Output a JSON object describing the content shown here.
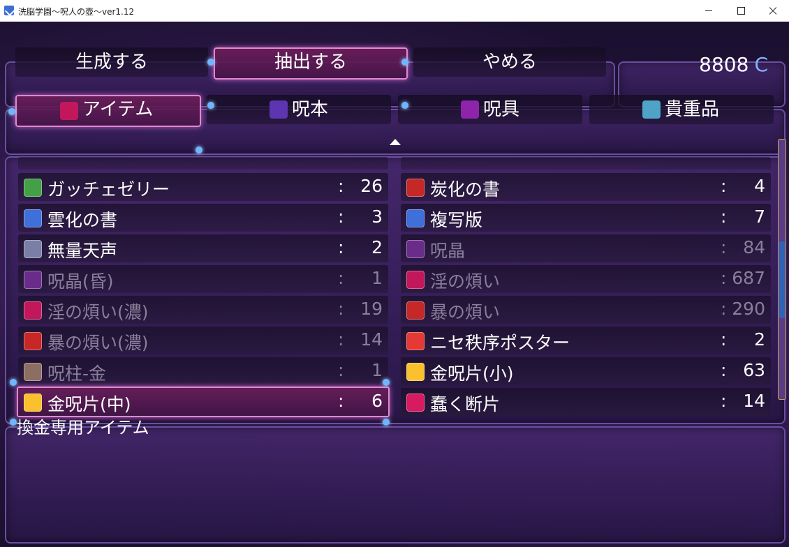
{
  "window": {
    "title": "洗脳学園～呪人の壺～ver1.12"
  },
  "commands": {
    "create_label": "生成する",
    "extract_label": "抽出する",
    "cancel_label": "やめる",
    "selected": "extract"
  },
  "gold": {
    "amount": "8808",
    "unit": "C"
  },
  "tabs": [
    {
      "label": "アイテム",
      "icon": "gem-icon",
      "color": "#c2185b",
      "selected": true
    },
    {
      "label": "呪本",
      "icon": "spellbook-icon",
      "color": "#5e35b1",
      "selected": false
    },
    {
      "label": "呪具",
      "icon": "skeleton-key-icon",
      "color": "#8e24aa",
      "selected": false
    },
    {
      "label": "貴重品",
      "icon": "frame-icon",
      "color": "#4fa3c7",
      "selected": false
    }
  ],
  "items_left": [
    {
      "name": "ガッチェゼリー",
      "count": "26",
      "icon": "mug-icon",
      "color": "#43a047",
      "dim": false,
      "selected": false
    },
    {
      "name": "雲化の書",
      "count": "3",
      "icon": "book-blue-icon",
      "color": "#3f6fd8",
      "dim": false,
      "selected": false
    },
    {
      "name": "無量天声",
      "count": "2",
      "icon": "book-white-icon",
      "color": "#7a7fa8",
      "dim": false,
      "selected": false
    },
    {
      "name": "呪晶(昏)",
      "count": "1",
      "icon": "dark-orb-icon",
      "color": "#6a2c8a",
      "dim": true,
      "selected": false
    },
    {
      "name": "淫の煩い(濃)",
      "count": "19",
      "icon": "pink-flame-icon",
      "color": "#c2185b",
      "dim": true,
      "selected": false
    },
    {
      "name": "暴の煩い(濃)",
      "count": "14",
      "icon": "red-flame-icon",
      "color": "#c62828",
      "dim": true,
      "selected": false
    },
    {
      "name": "呪柱-金",
      "count": "1",
      "icon": "pillar-icon",
      "color": "#8d6e63",
      "dim": true,
      "selected": false
    },
    {
      "name": "金呪片(中)",
      "count": "6",
      "icon": "gold-triangle-icon",
      "color": "#fbc02d",
      "dim": false,
      "selected": true
    }
  ],
  "items_right": [
    {
      "name": "炭化の書",
      "count": "4",
      "icon": "book-red-icon",
      "color": "#c62828",
      "dim": false,
      "selected": false
    },
    {
      "name": "複写版",
      "count": "7",
      "icon": "book-blue-icon",
      "color": "#3f6fd8",
      "dim": false,
      "selected": false
    },
    {
      "name": "呪晶",
      "count": "84",
      "icon": "dark-orb-icon",
      "color": "#6a2c8a",
      "dim": true,
      "selected": false
    },
    {
      "name": "淫の煩い",
      "count": "687",
      "icon": "pink-flame-icon",
      "color": "#c2185b",
      "dim": true,
      "selected": false
    },
    {
      "name": "暴の煩い",
      "count": "290",
      "icon": "red-flame-icon",
      "color": "#c62828",
      "dim": true,
      "selected": false
    },
    {
      "name": "ニセ秩序ポスター",
      "count": "2",
      "icon": "poster-icon",
      "color": "#e53935",
      "dim": false,
      "selected": false
    },
    {
      "name": "金呪片(小)",
      "count": "63",
      "icon": "gold-triangle-icon",
      "color": "#fbc02d",
      "dim": false,
      "selected": false
    },
    {
      "name": "蠢く断片",
      "count": "14",
      "icon": "ghost-fragment-icon",
      "color": "#d81b60",
      "dim": false,
      "selected": false
    }
  ],
  "help": {
    "text": "換金専用アイテム"
  }
}
